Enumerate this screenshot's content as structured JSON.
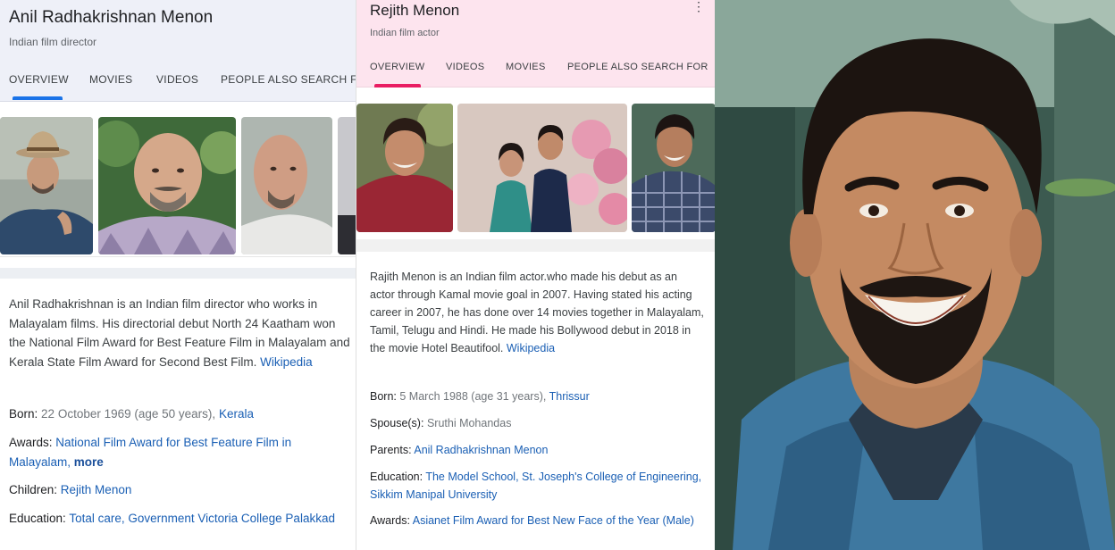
{
  "left_panel": {
    "title": "Anil Radhakrishnan Menon",
    "subtitle": "Indian film director",
    "tabs": [
      {
        "label": "OVERVIEW"
      },
      {
        "label": "MOVIES"
      },
      {
        "label": "VIDEOS"
      },
      {
        "label": "PEOPLE ALSO SEARCH F"
      }
    ],
    "description": "Anil Radhakrishnan is an Indian film director who works in Malayalam films. His directorial debut North 24 Kaatham won the National Film Award for Best Feature Film in Malayalam and Kerala State Film Award for Second Best Film.",
    "source_link": "Wikipedia",
    "facts": {
      "born": {
        "label": "Born:",
        "value": "22 October 1969 (age 50 years),",
        "link": "Kerala"
      },
      "awards": {
        "label": "Awards:",
        "link": "National Film Award for Best Feature Film in Malayalam,",
        "more": "more"
      },
      "children": {
        "label": "Children:",
        "link": "Rejith Menon"
      },
      "education": {
        "label": "Education:",
        "link": "Total care, Government Victoria College Palakkad"
      }
    }
  },
  "middle_panel": {
    "title": "Rejith Menon",
    "subtitle": "Indian film actor",
    "menu_glyph": "⋮",
    "tabs": [
      {
        "label": "OVERVIEW"
      },
      {
        "label": "VIDEOS"
      },
      {
        "label": "MOVIES"
      },
      {
        "label": "PEOPLE ALSO SEARCH FOR"
      }
    ],
    "description": "Rajith Menon is an Indian film actor.who made his debut as an actor through Kamal movie goal in 2007. Having stated his acting career in 2007, he has done over 14 movies together in Malayalam, Tamil, Telugu and Hindi. He made his Bollywood debut in 2018 in the movie Hotel Beautifool.",
    "source_link": "Wikipedia",
    "facts": {
      "born": {
        "label": "Born:",
        "value": "5 March 1988 (age 31 years),",
        "link": "Thrissur"
      },
      "spouse": {
        "label": "Spouse(s):",
        "value": "Sruthi Mohandas"
      },
      "parents": {
        "label": "Parents:",
        "link": "Anil Radhakrishnan Menon"
      },
      "education": {
        "label": "Education:",
        "link": "The Model School, St. Joseph's College of Engineering, Sikkim Manipal University"
      },
      "awards": {
        "label": "Awards:",
        "link": "Asianet Film Award for Best New Face of the Year (Male)"
      }
    }
  },
  "colors": {
    "left_header_bg": "#eef0f8",
    "middle_header_bg": "#fde4ee",
    "link": "#1a5fb4",
    "left_tab_accent": "#1a73e8",
    "middle_tab_accent": "#e91e63"
  }
}
